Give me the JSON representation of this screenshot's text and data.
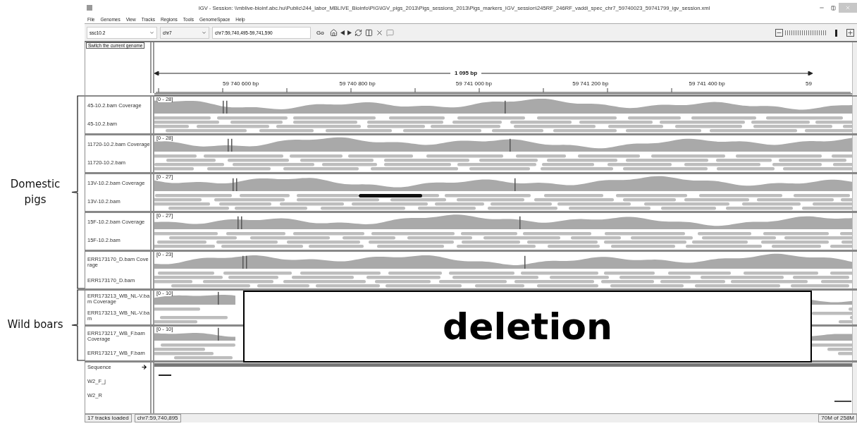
{
  "window": {
    "title": "IGV - Session: \\\\mblive-bioinf.abc.hu\\Public\\244_labor_MBLIVE_Bioinfo\\PIG\\IGV_pigs_2013\\Pigs_sessions_2013\\Pigs_markers_IGV_session\\245RF_246RF_vaddi_spec_chr7_59740023_59741799_igv_session.xml"
  },
  "menu": [
    "File",
    "Genomes",
    "View",
    "Tracks",
    "Regions",
    "Tools",
    "GenomeSpace",
    "Help"
  ],
  "toolbar": {
    "genome": "ssc10.2",
    "chromosome": "chr7",
    "locus": "chr7:59,740,495-59,741,590",
    "go": "Go",
    "tooltip": "Switch the current genome"
  },
  "zoom": {
    "level": 0.84
  },
  "ruler": {
    "span": "1 095 bp",
    "ticks": [
      "59 740 600 bp",
      "59 740 800 bp",
      "59 741 000 bp",
      "59 741 200 bp",
      "59 741 400 bp",
      "59"
    ]
  },
  "sample_sets": [
    {
      "label": "Domestic pigs",
      "deletion": false,
      "groups": [
        {
          "coverage": "45-10.2.bam Coverage",
          "range": "[0 - 28]",
          "reads": "45-10.2.bam"
        },
        {
          "coverage": "11720-10.2.bam Coverage",
          "range": "[0 - 28]",
          "reads": "11720-10.2.bam"
        },
        {
          "coverage": "13V-10.2.bam Coverage",
          "range": "[0 - 27]",
          "reads": "13V-10.2.bam"
        },
        {
          "coverage": "15F-10.2.bam Coverage",
          "range": "[0 - 27]",
          "reads": "15F-10.2.bam"
        },
        {
          "coverage": "ERR173170_D.bam Coverage",
          "range": "[0 - 23]",
          "reads": "ERR173170_D.bam"
        }
      ]
    },
    {
      "label": "Wild boars",
      "deletion": true,
      "groups": [
        {
          "coverage": "ERR173213_WB_NL-V.bam Coverage",
          "range": "[0 - 10]",
          "reads": "ERR173213_WB_NL-V.bam"
        },
        {
          "coverage": "ERR173217_WB_F.bam Coverage",
          "range": "[0 - 10]",
          "reads": "ERR173217_WB_F.bam"
        }
      ]
    }
  ],
  "callout": {
    "label": "deletion"
  },
  "sequence": {
    "label": "Sequence",
    "features": [
      "W2_F_j",
      "W2_R"
    ]
  },
  "status_bar": [
    "17 tracks loaded",
    "chr7:59,740,895",
    "70M of 258M"
  ]
}
